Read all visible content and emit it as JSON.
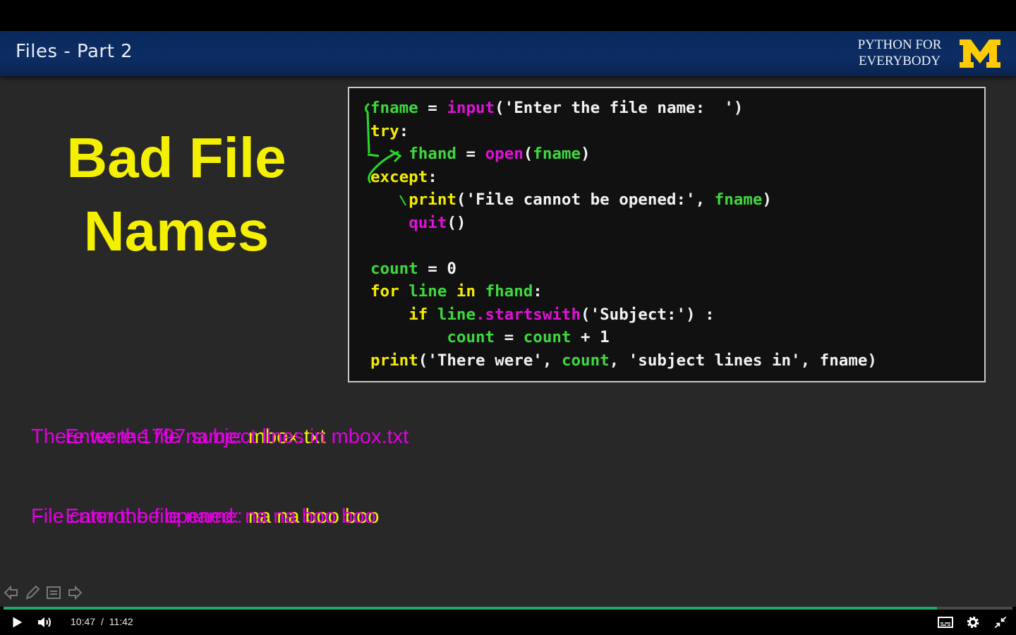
{
  "header": {
    "section_title": "Files - Part 2",
    "brand_line1": "PYTHON FOR",
    "brand_line2": "EVERYBODY",
    "logo_letter": "M"
  },
  "slide": {
    "title_line1": "Bad File",
    "title_line2": "Names"
  },
  "code": {
    "lines": [
      [
        [
          "var",
          "fname"
        ],
        [
          "plain",
          " = "
        ],
        [
          "fn",
          "input"
        ],
        [
          "plain",
          "('Enter the file name:  ')"
        ]
      ],
      [
        [
          "kw",
          "try"
        ],
        [
          "plain",
          ":"
        ]
      ],
      [
        [
          "plain",
          "    "
        ],
        [
          "var",
          "fhand"
        ],
        [
          "plain",
          " = "
        ],
        [
          "fn",
          "open"
        ],
        [
          "plain",
          "("
        ],
        [
          "var",
          "fname"
        ],
        [
          "plain",
          ")"
        ]
      ],
      [
        [
          "kw",
          "except"
        ],
        [
          "plain",
          ":"
        ]
      ],
      [
        [
          "plain",
          "    "
        ],
        [
          "kw",
          "print"
        ],
        [
          "plain",
          "('File cannot be opened:', "
        ],
        [
          "var",
          "fname"
        ],
        [
          "plain",
          ")"
        ]
      ],
      [
        [
          "plain",
          "    "
        ],
        [
          "fn",
          "quit"
        ],
        [
          "plain",
          "()"
        ]
      ],
      [
        [
          "plain",
          ""
        ]
      ],
      [
        [
          "var",
          "count"
        ],
        [
          "plain",
          " = 0"
        ]
      ],
      [
        [
          "kw",
          "for"
        ],
        [
          "plain",
          " "
        ],
        [
          "var",
          "line"
        ],
        [
          "plain",
          " "
        ],
        [
          "kw",
          "in"
        ],
        [
          "plain",
          " "
        ],
        [
          "var",
          "fhand"
        ],
        [
          "plain",
          ":"
        ]
      ],
      [
        [
          "plain",
          "    "
        ],
        [
          "kw",
          "if"
        ],
        [
          "plain",
          " "
        ],
        [
          "var",
          "line"
        ],
        [
          "fn",
          ".startswith"
        ],
        [
          "plain",
          "('Subject:') :"
        ]
      ],
      [
        [
          "plain",
          "        "
        ],
        [
          "var",
          "count"
        ],
        [
          "plain",
          " = "
        ],
        [
          "var",
          "count"
        ],
        [
          "plain",
          " + 1"
        ]
      ],
      [
        [
          "kw",
          "print"
        ],
        [
          "plain",
          "('There were', "
        ],
        [
          "var",
          "count"
        ],
        [
          "plain",
          ", 'subject lines in', fname)"
        ]
      ]
    ]
  },
  "output": {
    "run1_prompt": "Enter the file name: ",
    "run1_input": "mbox.txt",
    "run1_result": "There were 1797 subject lines in mbox.txt",
    "run2_prompt": "Enter the file name: ",
    "run2_input": "na na boo boo",
    "run2_result": "File cannot be opened: na na boo boo"
  },
  "player": {
    "current_time": "10:47",
    "separator": "/",
    "duration": "11:42",
    "progress_fraction": 0.925,
    "accent_color": "#1fa866",
    "icons": [
      "play-icon",
      "volume-icon",
      "captions-icon",
      "settings-icon",
      "exit-fullscreen-icon"
    ]
  },
  "colors": {
    "header_blue": "#0c2d63",
    "title_yellow": "#f4f000",
    "code_green": "#3ed83e",
    "code_magenta": "#e010d8",
    "output_pink": "#e000e0"
  }
}
